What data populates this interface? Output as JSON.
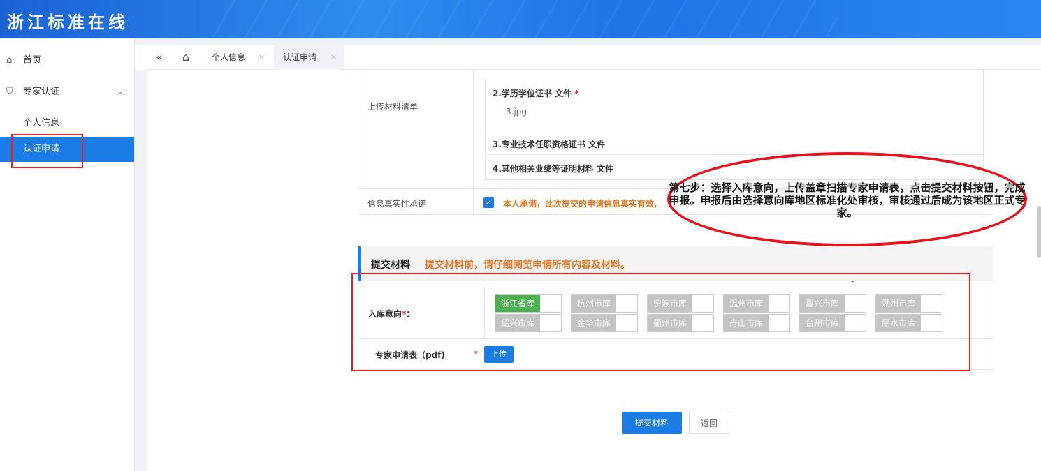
{
  "app": {
    "title": "浙江标准在线"
  },
  "sidebar": {
    "items": [
      {
        "label": "首页",
        "icon": "home-icon"
      },
      {
        "label": "专家认证",
        "icon": "shield-check-icon"
      },
      {
        "label": "个人信息"
      },
      {
        "label": "认证申请",
        "active": true
      }
    ]
  },
  "tabs": [
    {
      "label": "个人信息",
      "close": "×"
    },
    {
      "label": "认证申请",
      "close": "×",
      "active": true
    }
  ],
  "tab_icons": {
    "collapse": "«",
    "home": "⌂"
  },
  "form": {
    "upload_label": "上传材料清单",
    "files": [
      {
        "title": "2.学历学位证书 文件",
        "required_mark": "*",
        "file": "3.jpg"
      },
      {
        "title": "3.专业技术任职资格证书 文件"
      },
      {
        "title": "4.其他相关业绩等证明材料 文件"
      }
    ],
    "truth_label": "信息真实性承诺",
    "checkbox_mark": "✓",
    "promise_text": "本人承诺，此次提交的申请信息真实有效,"
  },
  "annotation": {
    "text": "第七步：选择入库意向，上传盖章扫描专家申请表，点击提交材料按钮，完成申报。申报后由选择意向库地区标准化处审核，审核通过后成为该地区正式专家。"
  },
  "submit_section": {
    "title": "提交材料",
    "hint": "提交材料前，请仔细阅览申请所有内容及材料。",
    "intent_label": "入库意向",
    "intent_required": "*",
    "intent_colon": "：",
    "options": [
      {
        "label": "浙江省库",
        "selected": true
      },
      {
        "label": "杭州市库"
      },
      {
        "label": "宁波市库"
      },
      {
        "label": "温州市库"
      },
      {
        "label": "嘉兴市库"
      },
      {
        "label": "湖州市库"
      },
      {
        "label": "绍兴市库"
      },
      {
        "label": "金华市库"
      },
      {
        "label": "衢州市库"
      },
      {
        "label": "舟山市库"
      },
      {
        "label": "台州市库"
      },
      {
        "label": "丽水市库"
      }
    ],
    "pdf_label": "专家申请表（pdf)",
    "pdf_required": "*",
    "upload_button": "上传"
  },
  "actions": {
    "submit": "提交材料",
    "back": "返回"
  },
  "colors": {
    "primary": "#1c7ce6",
    "warning": "#e87722",
    "annotation": "#e8121d",
    "selected": "#4caf50"
  }
}
